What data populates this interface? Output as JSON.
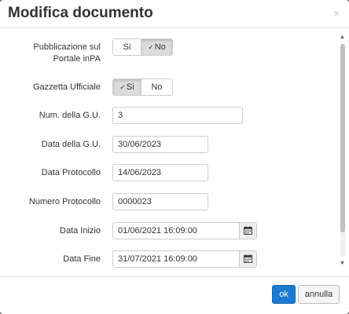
{
  "dialog": {
    "title": "Modifica documento",
    "close_label": "×"
  },
  "fields": {
    "pubblicazione": {
      "label": "Pubblicazione sul Portale inPA",
      "yes": "Si",
      "no": "No",
      "selected": "No"
    },
    "gazzetta": {
      "label": "Gazzetta Ufficiale",
      "yes": "Si",
      "no": "No",
      "selected": "Si"
    },
    "num_gu": {
      "label": "Num. della G.U.",
      "value": "3"
    },
    "data_gu": {
      "label": "Data della G.U.",
      "value": "30/06/2023"
    },
    "data_protocollo": {
      "label": "Data Protocollo",
      "value": "14/06/2023"
    },
    "numero_protocollo": {
      "label": "Numero Protocollo",
      "value": "0000023"
    },
    "data_inizio": {
      "label": "Data Inizio",
      "value": "01/06/2021 16:09:00"
    },
    "data_fine": {
      "label": "Data Fine",
      "value": "31/07/2021 16:09:00"
    }
  },
  "footer": {
    "ok_label": "ok",
    "cancel_label": "annulla"
  },
  "icons": {
    "check": "✓",
    "calendar": "calendar-icon"
  },
  "colors": {
    "primary": "#1a7bd0",
    "toggle_active": "#dcdcdc"
  }
}
